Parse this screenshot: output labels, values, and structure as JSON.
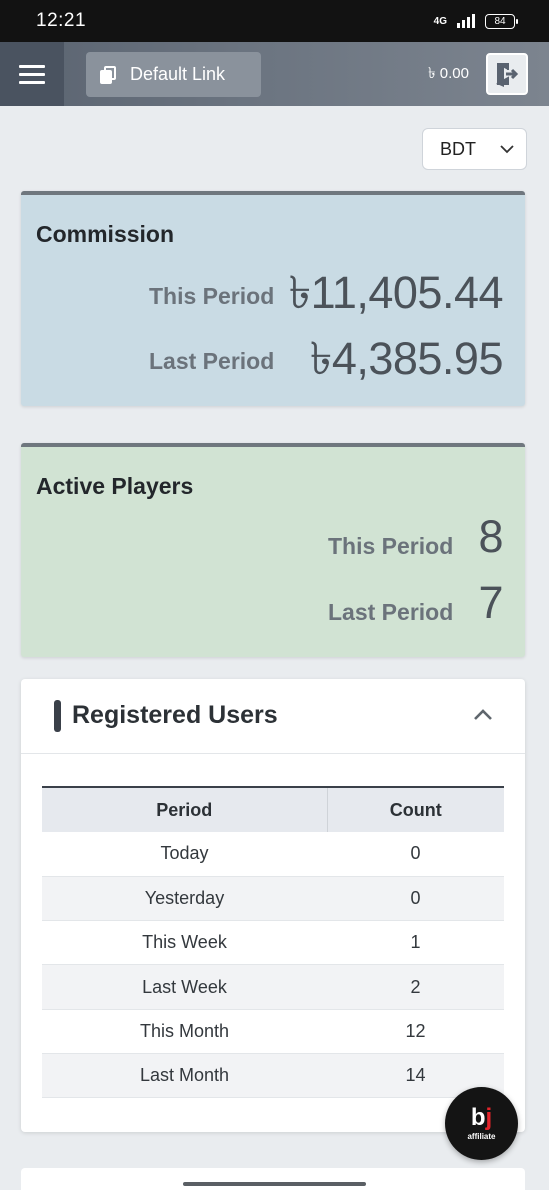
{
  "status_bar": {
    "time": "12:21",
    "network": "4G",
    "battery": "84"
  },
  "topnav": {
    "link_label": "Default Link",
    "balance": "৳ 0.00"
  },
  "currency": {
    "selected": "BDT"
  },
  "commission": {
    "title": "Commission",
    "this_period_label": "This Period",
    "this_period_value": "৳11,405.44",
    "last_period_label": "Last Period",
    "last_period_value": "৳4,385.95"
  },
  "active_players": {
    "title": "Active Players",
    "this_period_label": "This Period",
    "this_period_value": "8",
    "last_period_label": "Last Period",
    "last_period_value": "7"
  },
  "registered_users": {
    "title": "Registered Users",
    "columns": [
      "Period",
      "Count"
    ],
    "rows": [
      {
        "period": "Today",
        "count": "0"
      },
      {
        "period": "Yesterday",
        "count": "0"
      },
      {
        "period": "This Week",
        "count": "1"
      },
      {
        "period": "Last Week",
        "count": "2"
      },
      {
        "period": "This Month",
        "count": "12"
      },
      {
        "period": "Last Month",
        "count": "14"
      }
    ]
  },
  "fab": {
    "logo_b": "b",
    "logo_j": "j",
    "label": "affiliate"
  },
  "colors": {
    "commission_bg": "#c9dbe4",
    "players_bg": "#d1e3d3",
    "nav_dark": "#4a5360",
    "accent_red": "#e3242b"
  }
}
